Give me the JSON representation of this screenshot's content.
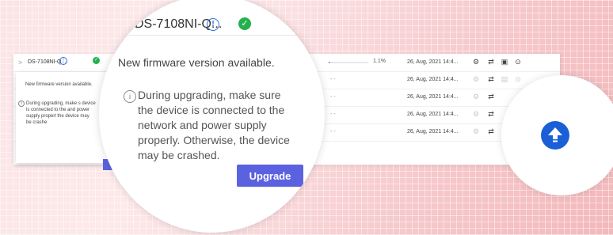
{
  "device_row": {
    "name_short": "DS-7108NI-Q...",
    "name_zoom": "DS-7108NI-Q...",
    "progress_percent": 1.1,
    "progress_text": "1.1%"
  },
  "rows": [
    {
      "status": "",
      "time": "26, Aug, 2021 14:4..."
    },
    {
      "status": "- -",
      "time": "26, Aug, 2021 14:4..."
    },
    {
      "status": "- -",
      "time": "26, Aug, 2021 14:4..."
    },
    {
      "status": "- -",
      "time": "26, Aug, 2021 14:4..."
    },
    {
      "status": "- -",
      "time": "26, Aug, 2021 14:4..."
    }
  ],
  "popover": {
    "title": "New firmware version available.",
    "message": "During upgrading, make sure the device is connected to the network and power supply properly. Otherwise, the device may be crashed.",
    "message_small": "During upgrading, make s device is connected to the and power supply properl the device may be crashe",
    "upgrade_label": "Upgrade",
    "upgrade_label_small": "U"
  },
  "icons": {
    "info": "info-circle-icon",
    "online": "check-circle-icon",
    "settings": "gear-icon",
    "sync": "sync-icon",
    "log": "log-icon",
    "upload": "upload-arrow-icon"
  },
  "colors": {
    "accent": "#5b62e0",
    "brand_blue": "#1b5fd6",
    "success": "#23b14d"
  }
}
